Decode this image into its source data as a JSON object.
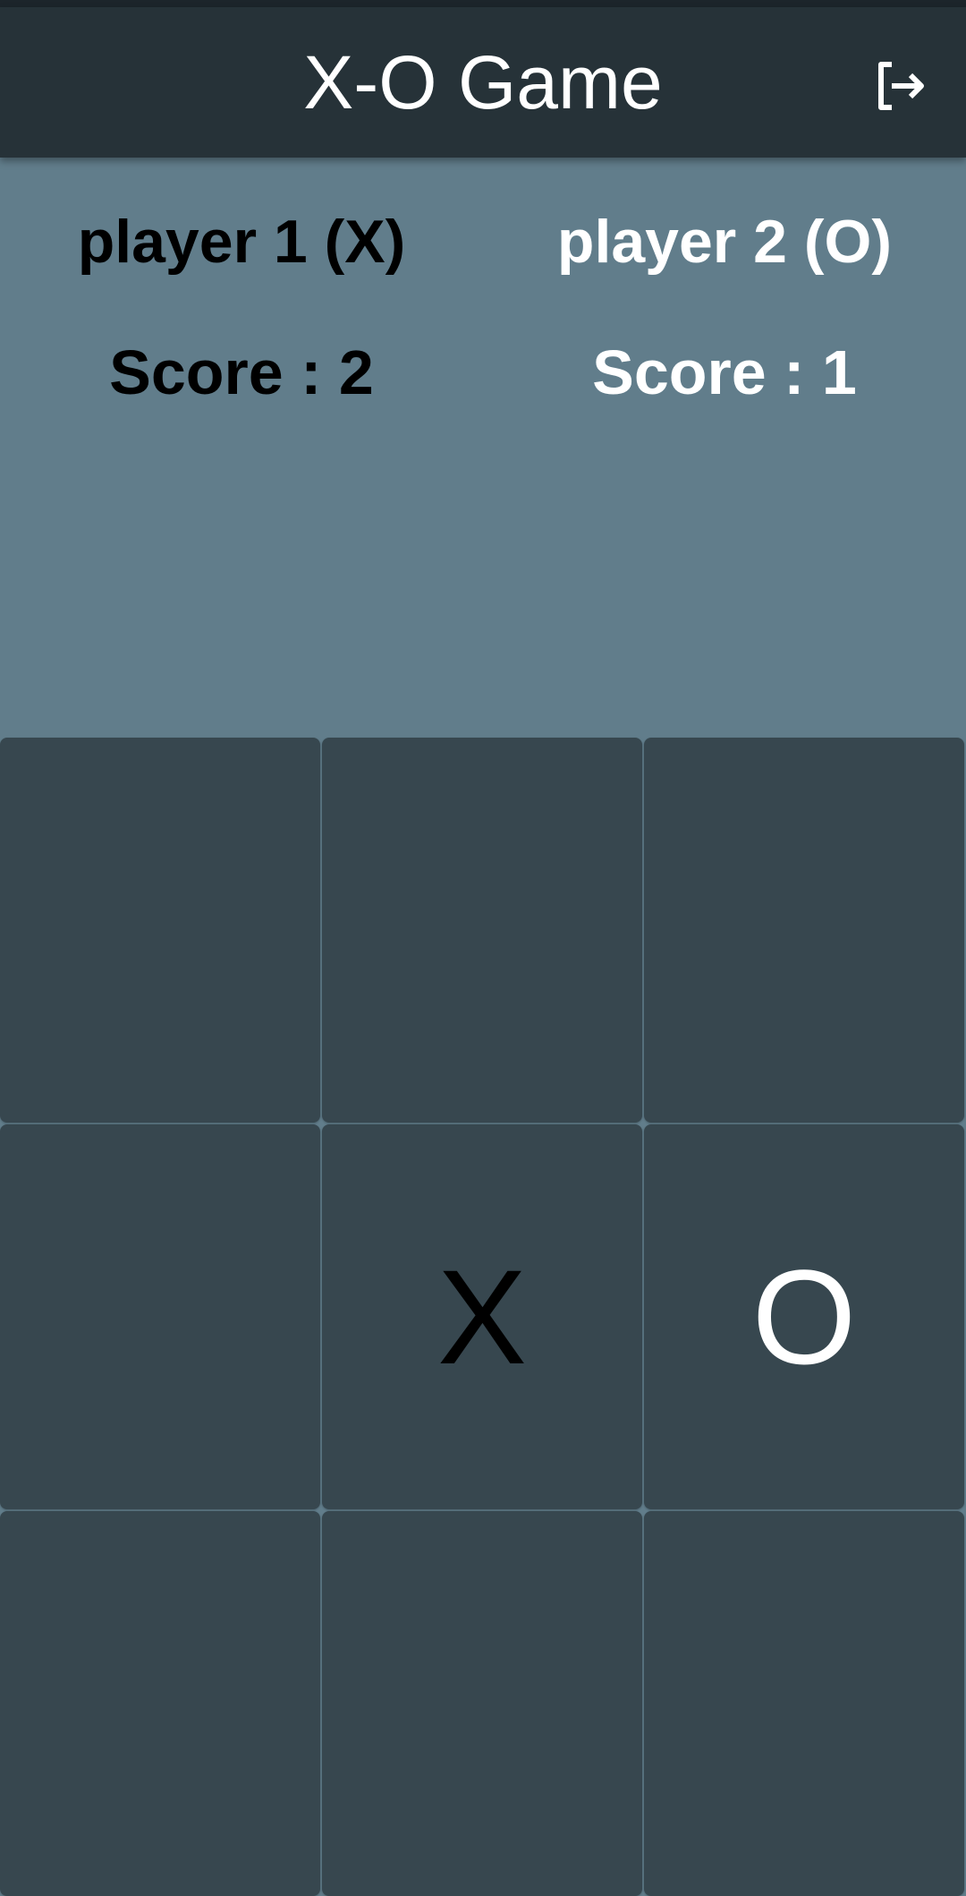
{
  "app_bar": {
    "title": "X-O Game",
    "logout_icon": "logout-icon"
  },
  "players": [
    {
      "name": "player 1 (X)",
      "score": "Score : 2",
      "color": "#000000"
    },
    {
      "name": "player 2 (O)",
      "score": "Score : 1",
      "color": "#ffffff"
    }
  ],
  "board": {
    "cells": [
      "",
      "",
      "",
      "",
      "X",
      "O",
      "",
      "",
      ""
    ]
  },
  "colors": {
    "app_bar": "#263238",
    "background": "#617d8b",
    "cell": "#37474f"
  }
}
